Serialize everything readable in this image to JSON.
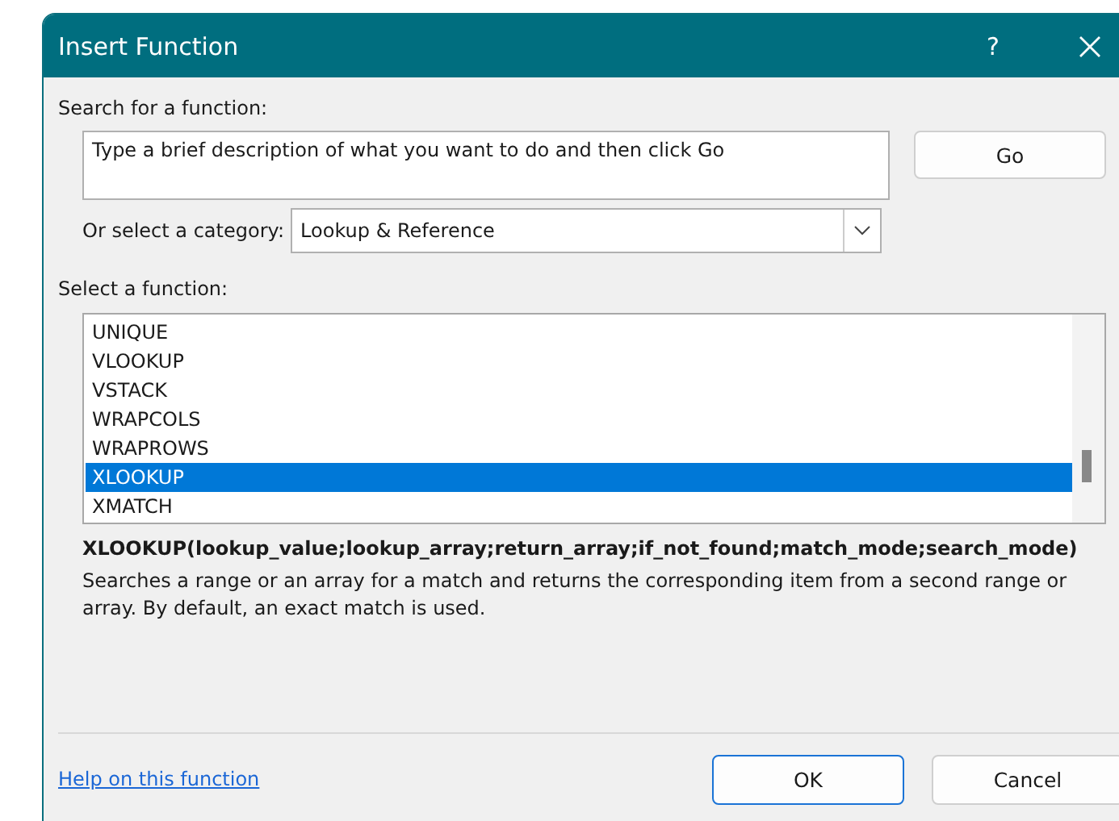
{
  "window": {
    "title": "Insert Function",
    "help_glyph": "?"
  },
  "search": {
    "label": "Search for a function:",
    "value": "Type a brief description of what you want to do and then click Go",
    "button": "Go"
  },
  "category": {
    "label": "Or select a category:",
    "value": "Lookup & Reference"
  },
  "functions": {
    "label": "Select a function:",
    "items": [
      {
        "name": "UNIQUE",
        "selected": false
      },
      {
        "name": "VLOOKUP",
        "selected": false
      },
      {
        "name": "VSTACK",
        "selected": false
      },
      {
        "name": "WRAPCOLS",
        "selected": false
      },
      {
        "name": "WRAPROWS",
        "selected": false
      },
      {
        "name": "XLOOKUP",
        "selected": true
      },
      {
        "name": "XMATCH",
        "selected": false
      }
    ]
  },
  "syntax": "XLOOKUP(lookup_value;lookup_array;return_array;if_not_found;match_mode;search_mode)",
  "description": "Searches a range or an array for a match and returns the corresponding item from a second range or array. By default, an exact match is used.",
  "help_link": "Help on this function",
  "buttons": [
    {
      "label": "OK",
      "default": true
    },
    {
      "label": "Cancel",
      "default": false
    }
  ]
}
